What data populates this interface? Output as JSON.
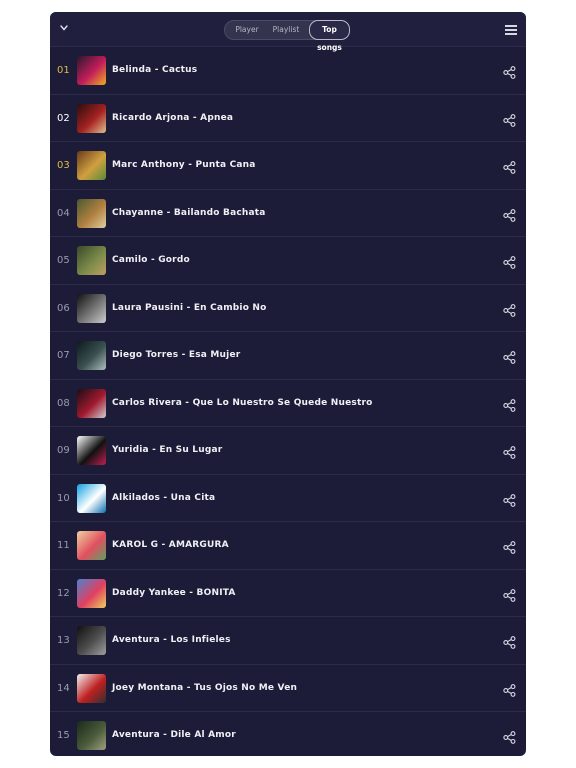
{
  "header": {
    "tabs": [
      "Player",
      "Playlist",
      "Top songs"
    ],
    "active_tab": "Top songs"
  },
  "songs": [
    {
      "rank": "01",
      "title": "Belinda  -  Cactus",
      "rank_color": "gold",
      "art": [
        "#2a1730",
        "#c21e5a",
        "#f0b020"
      ]
    },
    {
      "rank": "02",
      "title": "Ricardo Arjona - Apnea",
      "rank_color": "white",
      "art": [
        "#2a0e0e",
        "#a52121",
        "#e0c090"
      ]
    },
    {
      "rank": "03",
      "title": "Marc Anthony  -  Punta Cana",
      "rank_color": "gold",
      "art": [
        "#6a3a1a",
        "#d0a040",
        "#5a8a3a"
      ]
    },
    {
      "rank": "04",
      "title": "Chayanne  -  Bailando Bachata",
      "rank_color": "grey",
      "art": [
        "#4a5a30",
        "#b08040",
        "#e0d0a0"
      ]
    },
    {
      "rank": "05",
      "title": "Camilo  -  Gordo",
      "rank_color": "grey",
      "art": [
        "#3a4a2a",
        "#7a8a4a",
        "#c0a060"
      ]
    },
    {
      "rank": "06",
      "title": "Laura Pausini - En Cambio No",
      "rank_color": "grey",
      "art": [
        "#111111",
        "#777777",
        "#cccccc"
      ]
    },
    {
      "rank": "07",
      "title": "Diego Torres - Esa Mujer",
      "rank_color": "grey",
      "art": [
        "#0e1a1a",
        "#3a5050",
        "#b0c0c0"
      ]
    },
    {
      "rank": "08",
      "title": "Carlos Rivera - Que Lo Nuestro Se Quede Nuestro",
      "rank_color": "grey",
      "art": [
        "#1a0e14",
        "#a01a30",
        "#d0d0d0"
      ]
    },
    {
      "rank": "09",
      "title": "Yuridia - En Su Lugar",
      "rank_color": "grey",
      "art": [
        "#ffffff",
        "#111111",
        "#c02050"
      ]
    },
    {
      "rank": "10",
      "title": "Alkilados - Una Cita",
      "rank_color": "grey",
      "art": [
        "#10a0e0",
        "#ffffff",
        "#0a70b0"
      ]
    },
    {
      "rank": "11",
      "title": "KAROL G  -  AMARGURA",
      "rank_color": "grey",
      "art": [
        "#f0d0a0",
        "#e05060",
        "#60a060"
      ]
    },
    {
      "rank": "12",
      "title": "Daddy Yankee  -  BONITA",
      "rank_color": "grey",
      "art": [
        "#5080d0",
        "#e04060",
        "#f0d060"
      ]
    },
    {
      "rank": "13",
      "title": "Aventura - Los Infieles",
      "rank_color": "grey",
      "art": [
        "#101010",
        "#505050",
        "#a0a0a0"
      ]
    },
    {
      "rank": "14",
      "title": "Joey Montana - Tus Ojos No Me Ven",
      "rank_color": "grey",
      "art": [
        "#f0f0f0",
        "#c02020",
        "#303030"
      ]
    },
    {
      "rank": "15",
      "title": "Aventura - Dile Al Amor",
      "rank_color": "grey",
      "art": [
        "#1a2a1a",
        "#4a5a3a",
        "#a0a080"
      ]
    }
  ],
  "colors": {
    "background": "#1c1c38",
    "gold": "#e0b84a",
    "grey": "#9a9aaf",
    "white": "#ffffff"
  },
  "icons": {
    "collapse": "chevron-down-icon",
    "menu": "hamburger-menu-icon",
    "share": "share-icon"
  }
}
